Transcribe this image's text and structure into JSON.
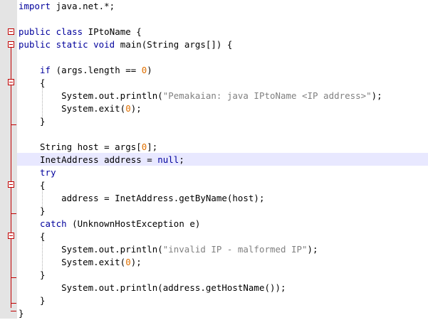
{
  "code": {
    "lines": [
      "import java.net.*;",
      "",
      "public class IPtoName {",
      "public static void main(String args[]) {",
      "",
      "    if (args.length == 0)",
      "    {",
      "        System.out.println(\"Pemakaian: java IPtoName <IP address>\");",
      "        System.exit(0);",
      "    }",
      "",
      "    String host = args[0];",
      "    InetAddress address = null;",
      "    try",
      "    {",
      "        address = InetAddress.getByName(host);",
      "    }",
      "    catch (UnknownHostException e)",
      "    {",
      "        System.out.println(\"invalid IP - malformed IP\");",
      "        System.exit(0);",
      "    }",
      "        System.out.println(address.getHostName());",
      "    }",
      "}"
    ],
    "highlighted_line": 13
  },
  "colors": {
    "keyword": "#00009c",
    "string": "#808080",
    "number": "#e07000",
    "fold_marker": "#c00000",
    "current_line": "#e8e8ff",
    "gutter": "#e4e4e4"
  }
}
